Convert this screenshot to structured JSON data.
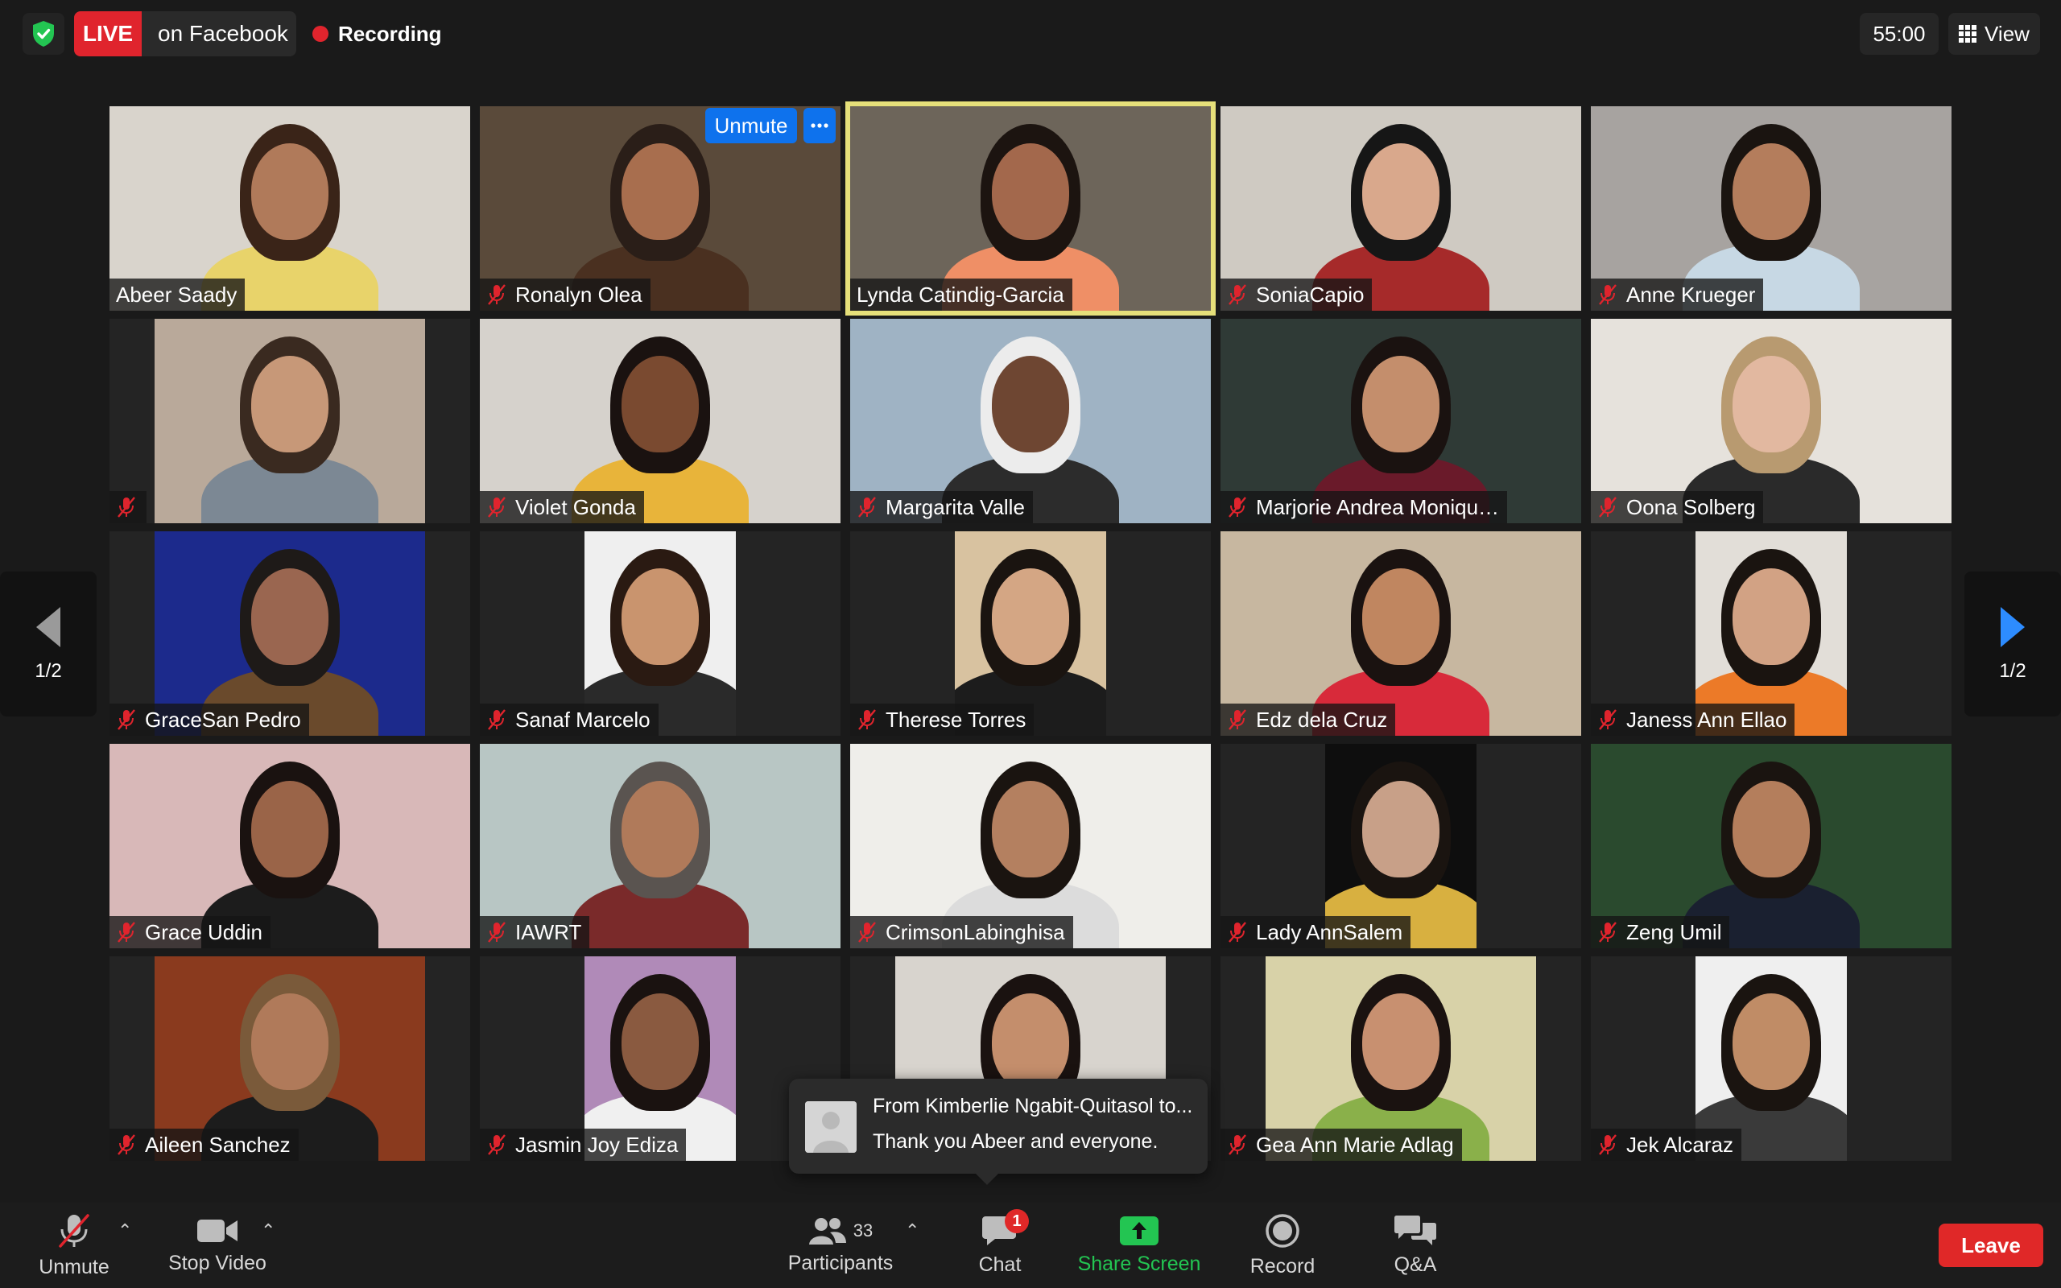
{
  "topbar": {
    "live_label": "LIVE",
    "live_destination": "on Facebook",
    "recording_label": "Recording",
    "timer": "55:00",
    "view_label": "View",
    "shield_color": "#23c552"
  },
  "active_tile": {
    "unmute_label": "Unmute",
    "more_label": "•••"
  },
  "participants": [
    {
      "name": "Abeer Saady",
      "muted": false
    },
    {
      "name": "Ronalyn Olea",
      "muted": true
    },
    {
      "name": "Lynda Catindig-Garcia",
      "muted": false,
      "speaking": true
    },
    {
      "name": "SoniaCapio",
      "muted": true
    },
    {
      "name": "Anne Krueger",
      "muted": true
    },
    {
      "name": "",
      "muted": true
    },
    {
      "name": "Violet Gonda",
      "muted": true
    },
    {
      "name": "Margarita Valle",
      "muted": true
    },
    {
      "name": "Marjorie Andrea Moniqu…",
      "muted": true
    },
    {
      "name": "Oona Solberg",
      "muted": true
    },
    {
      "name": "GraceSan Pedro",
      "muted": true
    },
    {
      "name": "Sanaf Marcelo",
      "muted": true
    },
    {
      "name": "Therese Torres",
      "muted": true
    },
    {
      "name": "Edz dela Cruz",
      "muted": true
    },
    {
      "name": "Janess Ann Ellao",
      "muted": true
    },
    {
      "name": "Grace Uddin",
      "muted": true
    },
    {
      "name": "IAWRT",
      "muted": true
    },
    {
      "name": "CrimsonLabinghisa",
      "muted": true
    },
    {
      "name": "Lady AnnSalem",
      "muted": true
    },
    {
      "name": "Zeng Umil",
      "muted": true
    },
    {
      "name": "Aileen Sanchez",
      "muted": true
    },
    {
      "name": "Jasmin Joy Ediza",
      "muted": true
    },
    {
      "name": "",
      "muted": false
    },
    {
      "name": "Gea Ann Marie Adlag",
      "muted": true
    },
    {
      "name": "Jek Alcaraz",
      "muted": true
    }
  ],
  "pager": {
    "left": "1/2",
    "right": "1/2"
  },
  "chat_toast": {
    "from": "From Kimberlie Ngabit-Quitasol to...",
    "message": "Thank you Abeer and everyone."
  },
  "toolbar": {
    "unmute_label": "Unmute",
    "stop_video_label": "Stop Video",
    "participants_label": "Participants",
    "participants_count": "33",
    "chat_label": "Chat",
    "chat_badge": "1",
    "share_label": "Share Screen",
    "record_label": "Record",
    "qa_label": "Q&A",
    "leave_label": "Leave",
    "share_color": "#23c552",
    "leave_color": "#e02828"
  }
}
